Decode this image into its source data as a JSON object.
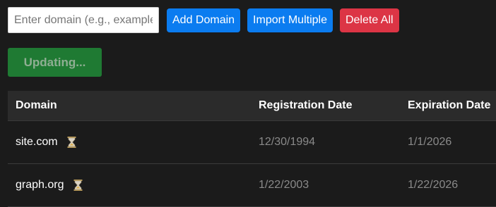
{
  "toolbar": {
    "domain_input_placeholder": "Enter domain (e.g., example.com)",
    "domain_input_value": "",
    "add_label": "Add Domain",
    "import_label": "Import Multiple",
    "delete_all_label": "Delete All"
  },
  "update_button_label": "Updating...",
  "table": {
    "columns": [
      "Domain",
      "Registration Date",
      "Expiration Date"
    ],
    "rows": [
      {
        "domain": "site.com",
        "status_icon": "hourglass-icon",
        "registration_date": "12/30/1994",
        "expiration_date": "1/1/2026"
      },
      {
        "domain": "graph.org",
        "status_icon": "hourglass-icon",
        "registration_date": "1/22/2003",
        "expiration_date": "1/22/2026"
      }
    ]
  },
  "colors": {
    "background": "#1b1b1b",
    "primary_button": "#0b7cf0",
    "danger_button": "#dc3545",
    "updating_button": "#1f7a33",
    "table_header": "#2b2b2b",
    "date_text": "#8a8a8a"
  }
}
